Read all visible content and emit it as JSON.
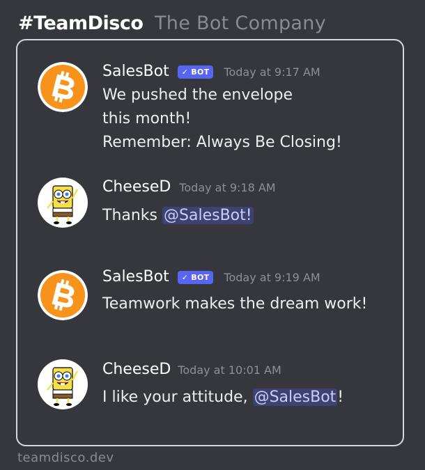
{
  "header": {
    "brand": "#TeamDisco",
    "tagline": "The Bot Company"
  },
  "footer": {
    "domain": "teamdisco.dev"
  },
  "badge": {
    "label": "BOT",
    "check": "✓"
  },
  "colors": {
    "badge": "#5865f2",
    "bitcoin": "#f7931a",
    "mention_bg": "#3d4270"
  },
  "messages": [
    {
      "username": "SalesBot",
      "avatar": "bitcoin-icon",
      "bot": true,
      "time": "Today at 9:17 AM",
      "lines": [
        "We pushed the envelope",
        "this month!",
        "Remember: Always Be Closing!"
      ]
    },
    {
      "username": "CheeseD",
      "avatar": "spongebob-avatar",
      "bot": false,
      "time": "Today at 9:18 AM",
      "text_before": "Thanks ",
      "mention": "@SalesBot!",
      "text_after": ""
    },
    {
      "username": "SalesBot",
      "avatar": "bitcoin-icon",
      "bot": true,
      "time": "Today at 9:19 AM",
      "lines": [
        "Teamwork makes the dream work!"
      ]
    },
    {
      "username": "CheeseD",
      "avatar": "spongebob-avatar",
      "bot": false,
      "time": "Today at 10:01 AM",
      "text_before": "I like your attitude, ",
      "mention": "@SalesBot",
      "text_after": "!"
    }
  ]
}
